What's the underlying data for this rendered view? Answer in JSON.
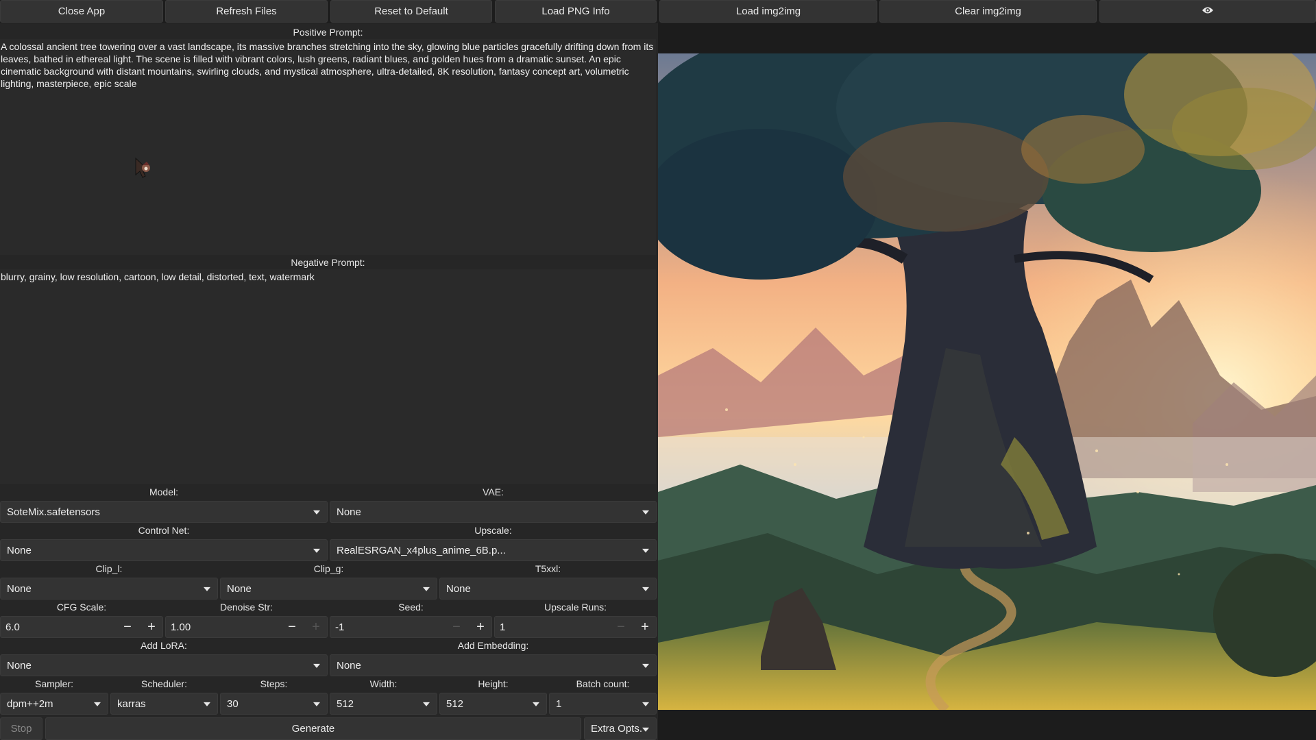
{
  "toolbar": {
    "close_app": "Close App",
    "refresh_files": "Refresh Files",
    "reset_default": "Reset to Default",
    "load_png_info": "Load PNG Info",
    "load_img2img": "Load img2img",
    "clear_img2img": "Clear img2img",
    "preview_icon": "eye-icon"
  },
  "prompts": {
    "positive_label": "Positive Prompt:",
    "positive_text": "A colossal ancient tree towering over a vast landscape, its massive branches stretching into the sky, glowing blue particles gracefully drifting down from its leaves, bathed in ethereal light. The scene is filled with vibrant colors, lush greens, radiant blues, and golden hues from a dramatic sunset. An epic cinematic background with distant mountains, swirling clouds, and mystical atmosphere, ultra-detailed, 8K resolution, fantasy concept art, volumetric lighting, masterpiece, epic scale",
    "negative_label": "Negative Prompt:",
    "negative_text": "blurry, grainy, low resolution, cartoon, low detail, distorted, text, watermark"
  },
  "settings": {
    "model_label": "Model:",
    "model_value": "SoteMix.safetensors",
    "vae_label": "VAE:",
    "vae_value": "None",
    "controlnet_label": "Control Net:",
    "controlnet_value": "None",
    "upscale_label": "Upscale:",
    "upscale_value": "RealESRGAN_x4plus_anime_6B.p...",
    "clip_l_label": "Clip_l:",
    "clip_l_value": "None",
    "clip_g_label": "Clip_g:",
    "clip_g_value": "None",
    "t5xxl_label": "T5xxl:",
    "t5xxl_value": "None",
    "cfg_label": "CFG Scale:",
    "cfg_value": "6.0",
    "denoise_label": "Denoise Str:",
    "denoise_value": "1.00",
    "seed_label": "Seed:",
    "seed_value": "-1",
    "upscale_runs_label": "Upscale Runs:",
    "upscale_runs_value": "1",
    "lora_label": "Add LoRA:",
    "lora_value": "None",
    "embedding_label": "Add Embedding:",
    "embedding_value": "None",
    "sampler_label": "Sampler:",
    "sampler_value": "dpm++2m",
    "scheduler_label": "Scheduler:",
    "scheduler_value": "karras",
    "steps_label": "Steps:",
    "steps_value": "30",
    "width_label": "Width:",
    "width_value": "512",
    "height_label": "Height:",
    "height_value": "512",
    "batch_label": "Batch count:",
    "batch_value": "1",
    "minus_glyph": "−",
    "plus_glyph": "+"
  },
  "actions": {
    "stop": "Stop",
    "generate": "Generate",
    "extra_opts": "Extra Opts."
  }
}
